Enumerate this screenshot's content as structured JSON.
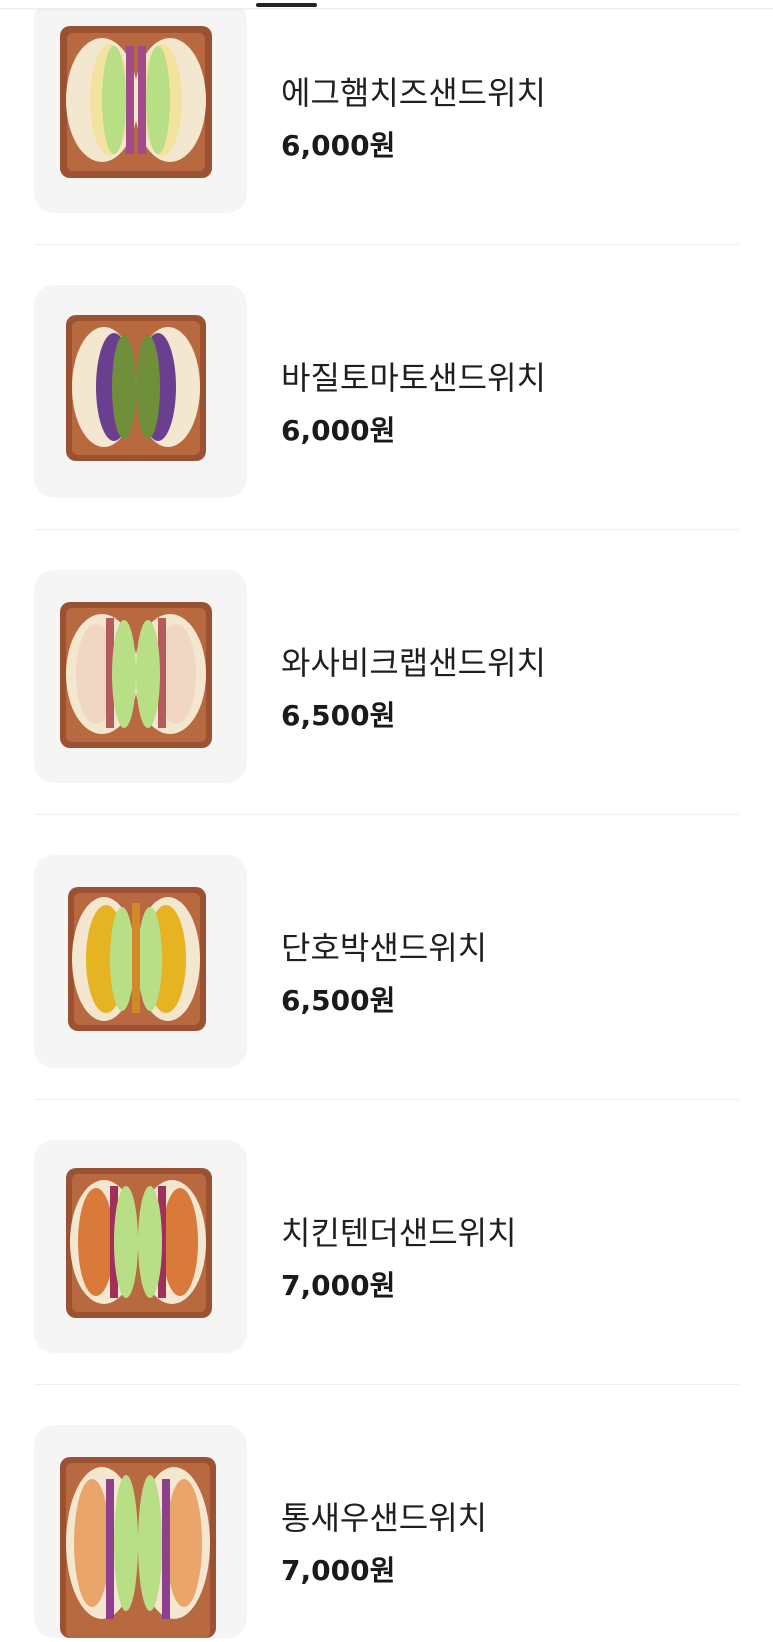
{
  "menu": {
    "items": [
      {
        "name": "에그햄치즈샌드위치",
        "price": "6,000원",
        "image": "egg-ham-cheese-sandwich-image",
        "filling_color": "#f3e2a0",
        "accent_color": "#a34b8a"
      },
      {
        "name": "바질토마토샌드위치",
        "price": "6,000원",
        "image": "basil-tomato-sandwich-image",
        "filling_color": "#6f8f3a",
        "accent_color": "#6b3f8f"
      },
      {
        "name": "와사비크랩샌드위치",
        "price": "6,500원",
        "image": "wasabi-crab-sandwich-image",
        "filling_color": "#f0d7c3",
        "accent_color": "#b75a5a"
      },
      {
        "name": "단호박샌드위치",
        "price": "6,500원",
        "image": "sweet-pumpkin-sandwich-image",
        "filling_color": "#e6b323",
        "accent_color": "#d08a2a"
      },
      {
        "name": "치킨텐더샌드위치",
        "price": "7,000원",
        "image": "chicken-tender-sandwich-image",
        "filling_color": "#d9793a",
        "accent_color": "#a0305a"
      },
      {
        "name": "통새우샌드위치",
        "price": "7,000원",
        "image": "whole-shrimp-sandwich-image",
        "filling_color": "#e9a56a",
        "accent_color": "#8e3f8e"
      }
    ]
  },
  "colors": {
    "thumbnail_bg": "#f5f5f5",
    "tray": "#9a5232",
    "bread": "#f4e7cf",
    "lettuce": "#b8de86"
  }
}
